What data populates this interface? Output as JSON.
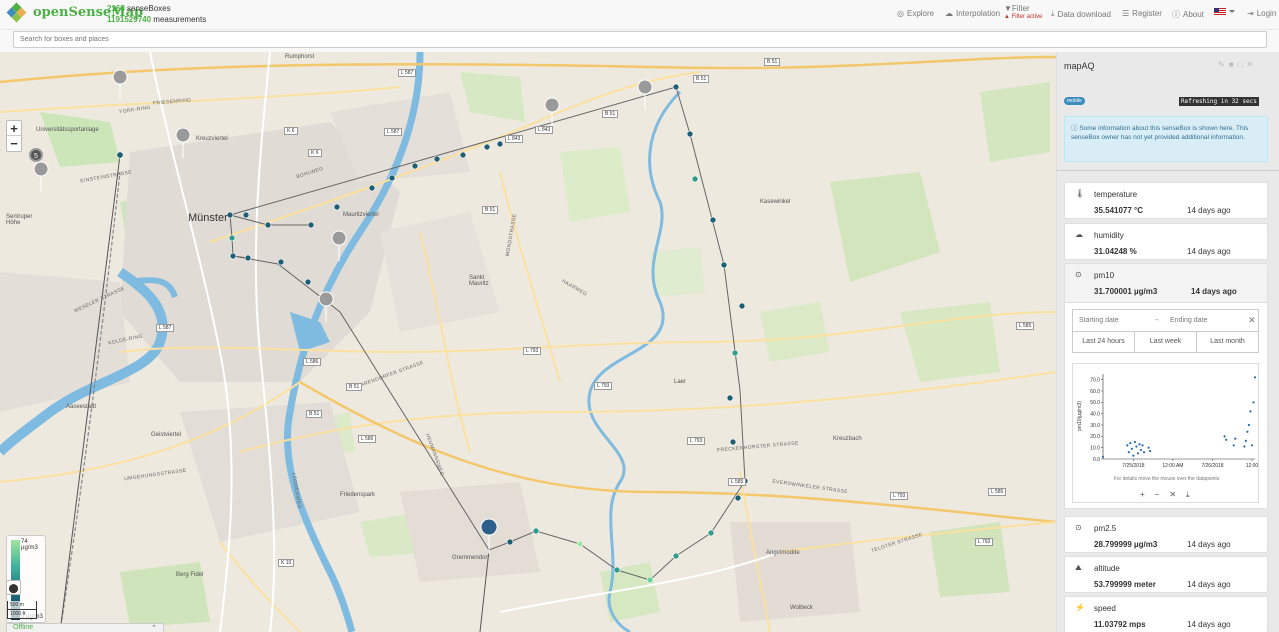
{
  "navbar": {
    "brand": "openSenseMap",
    "stats": {
      "boxes_count": "2168",
      "boxes_label": "senseBoxes",
      "measurements_count": "1191529740",
      "measurements_label": "measurements"
    },
    "explore": "Explore",
    "interpolation": "Interpolation",
    "filter": "Filter",
    "filter_status": "Filter active",
    "data_download": "Data download",
    "register": "Register",
    "about": "About",
    "login": "Login"
  },
  "search": {
    "placeholder": "Search for boxes and places"
  },
  "map": {
    "zoom_in": "+",
    "zoom_out": "−",
    "legend_max": "74 µg/m3",
    "legend_min": "0 µg/m3",
    "scale_metric": "500 m",
    "scale_imperial": "1000 ft",
    "tray_label": "Offline",
    "cluster_count": "5",
    "labels": {
      "city": "Münster",
      "mauritz": "Mauritzviertel",
      "kreuz": "Kreuzviertel",
      "sentrup": "Sentruper Höhe",
      "aasee": "Aaseestadt",
      "geist": "Geistviertel",
      "berg": "Berg Fidel",
      "gremmendorf": "Gremmendorf",
      "sankt": "Sankt Mauritz",
      "kasewinkel": "Kasewinkel",
      "kreuzbach": "Kreuzbach",
      "laer": "Laer",
      "wolbeck": "Wolbeck",
      "friedenspark": "Friedenspark",
      "angelmodde": "Angelmodde",
      "rumphorst": "Rumphorst",
      "schloss": "Universitätssportanlage"
    },
    "roads": {
      "b51a": "B 51",
      "b51b": "B 51",
      "b51c": "B 51",
      "b51d": "B 51",
      "b51e": "B 51",
      "b51f": "B 51",
      "l587a": "L 587",
      "l587b": "L 587",
      "l587c": "L 587",
      "l843a": "L 843",
      "l843b": "L 843",
      "k6a": "K 6",
      "k6b": "K 6",
      "l793a": "L 793",
      "l793b": "L 793",
      "l793c": "L 793",
      "l793d": "L 793",
      "l793e": "L 793",
      "l585a": "L 585",
      "l585b": "L 585",
      "l585c": "L 585",
      "l586a": "L 586",
      "l586b": "L 586",
      "k10": "K 10"
    },
    "streets": {
      "einstein": "EINSTEINSTRASSE",
      "umgehung": "UMGEHUNGSSTRASSE",
      "weseler": "WESELER STRASSE",
      "freckenhorster": "FRECKENHORSTER STRASSE",
      "everswinkeler": "EVERSWINKELER STRASSE",
      "telgter": "TELGTER STRASSE",
      "kolde": "KOLDE-RING",
      "york": "YORK-RING",
      "friesen": "FRIESENRING",
      "bohlweg": "BOHLWEG",
      "warendorfer": "WARENDORFER STRASSE",
      "mondstrasse": "MONDSTRASSE",
      "heumannsweg": "HEUMANNSWEG",
      "loddenweg": "LODDENWEG",
      "hagenbeck": "HAARWEG"
    }
  },
  "sidebar": {
    "title": "mapAQ",
    "badge": "mobile",
    "refresh": "Refreshing in 32 secs",
    "info": "Some information about this senseBox is shown here. This senseBox owner has not yet provided additional information.",
    "sensors": [
      {
        "name": "temperature",
        "value": "35.541077 °C",
        "ago": "14 days ago",
        "icon": "thermometer-icon"
      },
      {
        "name": "humidity",
        "value": "31.04248 %",
        "ago": "14 days ago",
        "icon": "cloud-icon"
      },
      {
        "name": "pm10",
        "value": "31.700001 µg/m3",
        "ago": "14 days ago",
        "icon": "pin-icon"
      },
      {
        "name": "pm2.5",
        "value": "28.799999 µg/m3",
        "ago": "14 days ago",
        "icon": "pin-icon"
      },
      {
        "name": "altitude",
        "value": "53.799999 meter",
        "ago": "14 days ago",
        "icon": "altitude-icon"
      },
      {
        "name": "speed",
        "value": "11.03792 mps",
        "ago": "14 days ago",
        "icon": "speed-icon"
      }
    ],
    "chart": {
      "start_placeholder": "Starting date",
      "end_placeholder": "Ending date",
      "quick": [
        "Last 24 hours",
        "Last week",
        "Last month"
      ],
      "note": "For details move the mouse over the datapoints"
    }
  },
  "chart_data": {
    "type": "scatter",
    "ylabel": "pm10(µg/m3)",
    "ylim": [
      0,
      75
    ],
    "yticks": [
      "70.0",
      "60.0",
      "50.0",
      "40.0",
      "30.0",
      "20.0",
      "10.0",
      "0.0"
    ],
    "xticks": [
      "7/25/2018",
      "12:00 AM",
      "7/26/2018",
      "12:00"
    ],
    "series": [
      {
        "points": [
          [
            0.0,
            2
          ],
          [
            0.16,
            12
          ],
          [
            0.17,
            6
          ],
          [
            0.18,
            14
          ],
          [
            0.19,
            9
          ],
          [
            0.2,
            3
          ],
          [
            0.21,
            15
          ],
          [
            0.22,
            11
          ],
          [
            0.23,
            5
          ],
          [
            0.24,
            13
          ],
          [
            0.25,
            8
          ],
          [
            0.26,
            12
          ],
          [
            0.27,
            6
          ],
          [
            0.3,
            10
          ],
          [
            0.31,
            7
          ],
          [
            0.8,
            20
          ],
          [
            0.81,
            17
          ],
          [
            0.86,
            12
          ],
          [
            0.87,
            18
          ],
          [
            0.93,
            11
          ],
          [
            0.94,
            16
          ],
          [
            0.95,
            24
          ],
          [
            0.96,
            30
          ],
          [
            0.97,
            42
          ],
          [
            0.98,
            12
          ],
          [
            0.99,
            50
          ],
          [
            1.0,
            72
          ]
        ]
      }
    ]
  },
  "colors": {
    "brand": "#4eaf47",
    "track_high": "#9fe6a0",
    "track_mid": "#3fb29c",
    "track_low": "#1e6d80",
    "chart_point": "#2b6aa6"
  }
}
